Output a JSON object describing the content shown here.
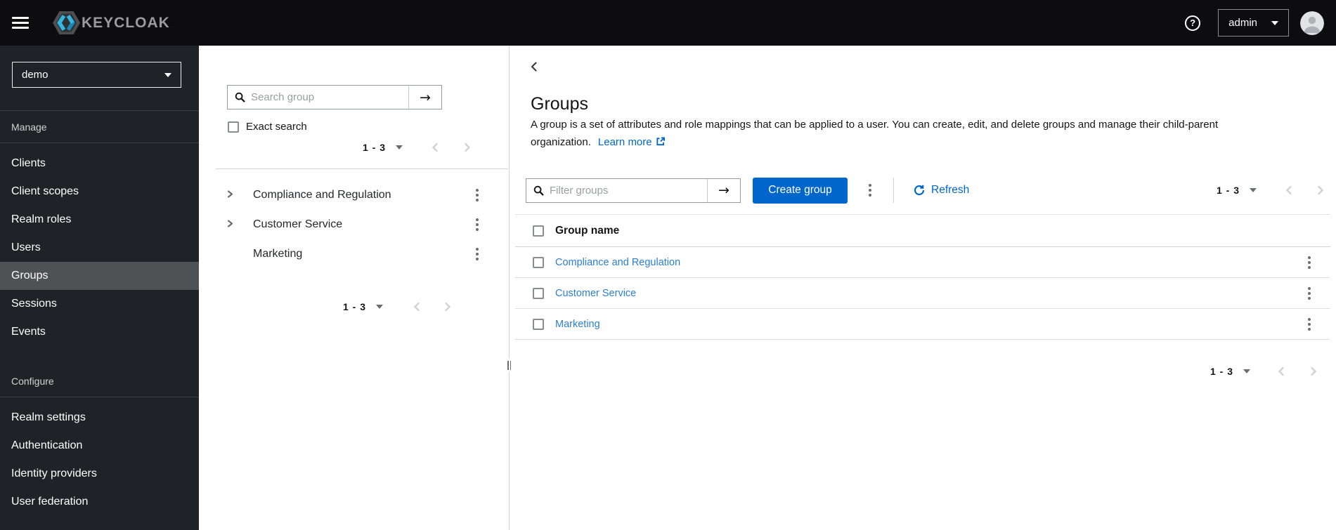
{
  "header": {
    "brand": "KEYCLOAK",
    "username": "admin",
    "help_glyph": "?"
  },
  "sidebar": {
    "realm": "demo",
    "sections": [
      {
        "label": "Manage",
        "items": [
          {
            "label": "Clients",
            "active": false
          },
          {
            "label": "Client scopes",
            "active": false
          },
          {
            "label": "Realm roles",
            "active": false
          },
          {
            "label": "Users",
            "active": false
          },
          {
            "label": "Groups",
            "active": true
          },
          {
            "label": "Sessions",
            "active": false
          },
          {
            "label": "Events",
            "active": false
          }
        ]
      },
      {
        "label": "Configure",
        "items": [
          {
            "label": "Realm settings",
            "active": false
          },
          {
            "label": "Authentication",
            "active": false
          },
          {
            "label": "Identity providers",
            "active": false
          },
          {
            "label": "User federation",
            "active": false
          }
        ]
      }
    ]
  },
  "tree_panel": {
    "search_placeholder": "Search group",
    "exact_search_label": "Exact search",
    "pagination_top": "1 - 3",
    "pagination_bottom": "1 - 3",
    "items": [
      {
        "label": "Compliance and Regulation",
        "expandable": true
      },
      {
        "label": "Customer Service",
        "expandable": true
      },
      {
        "label": "Marketing",
        "expandable": false
      }
    ]
  },
  "main": {
    "title": "Groups",
    "description": "A group is a set of attributes and role mappings that can be applied to a user. You can create, edit, and delete groups and manage their child-parent organization.",
    "learn_more_label": "Learn more",
    "filter_placeholder": "Filter groups",
    "create_button_label": "Create group",
    "refresh_label": "Refresh",
    "toolbar_pagination": "1 - 3",
    "table_pagination": "1 - 3",
    "table": {
      "header": "Group name",
      "rows": [
        {
          "name": "Compliance and Regulation"
        },
        {
          "name": "Customer Service"
        },
        {
          "name": "Marketing"
        }
      ]
    }
  },
  "icons": {
    "arrow_right": "→"
  },
  "colors": {
    "primary": "#0066cc",
    "row_link": "#2b7fd4",
    "masthead_bg": "#0d0d0f",
    "sidebar_bg": "#1f2226",
    "sidebar_active": "#4f5255",
    "disabled_chevron": "#d2d2d2"
  }
}
